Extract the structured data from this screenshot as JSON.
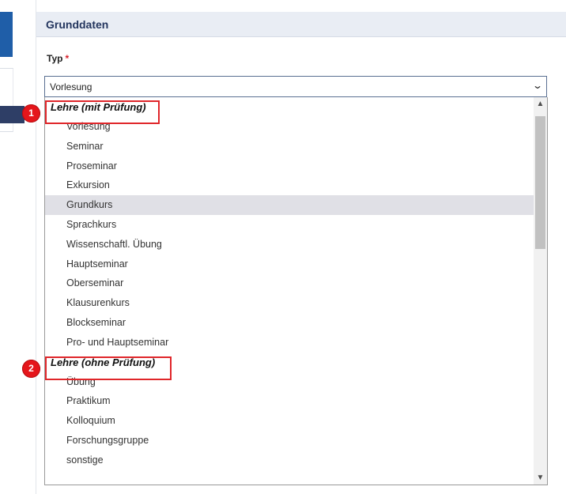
{
  "section": {
    "title": "Grunddaten"
  },
  "field": {
    "label": "Typ",
    "required_marker": "*"
  },
  "select": {
    "value": "Vorlesung"
  },
  "dropdown": {
    "group1": {
      "label": "Lehre (mit Prüfung)",
      "options": [
        "Vorlesung",
        "Seminar",
        "Proseminar",
        "Exkursion",
        "Grundkurs",
        "Sprachkurs",
        "Wissenschaftl. Übung",
        "Hauptseminar",
        "Oberseminar",
        "Klausurenkurs",
        "Blockseminar",
        "Pro- und Hauptseminar"
      ]
    },
    "group2": {
      "label": "Lehre (ohne Prüfung)",
      "options": [
        "Übung",
        "Praktikum",
        "Kolloquium",
        "Forschungsgruppe",
        "sonstige"
      ]
    },
    "highlighted_option": "Grundkurs"
  },
  "annotations": {
    "badge1": "1",
    "badge2": "2"
  },
  "icons": {
    "select_chevron": "chevron-down-icon",
    "scroll_up": "scroll-up-arrow-icon",
    "scroll_down": "scroll-down-arrow-icon"
  },
  "colors": {
    "annotation_red": "#e0262a",
    "header_bg": "#e9edf4",
    "header_text": "#23355e",
    "required": "#d8202a"
  }
}
